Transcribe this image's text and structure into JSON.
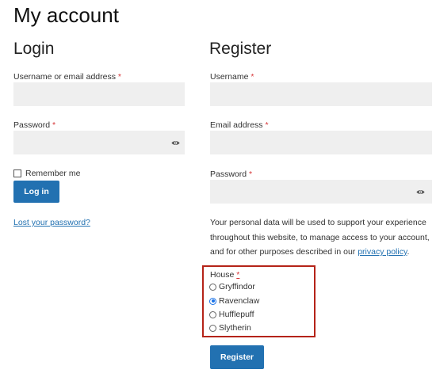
{
  "page": {
    "title": "My account"
  },
  "login": {
    "title": "Login",
    "username_label": "Username or email address",
    "password_label": "Password",
    "required_mark": "*",
    "remember_label": "Remember me",
    "submit_label": "Log in",
    "lost_password": "Lost your password?"
  },
  "register": {
    "title": "Register",
    "username_label": "Username",
    "email_label": "Email address",
    "password_label": "Password",
    "required_mark": "*",
    "privacy_text": "Your personal data will be used to support your experience throughout this website, to manage access to your account, and for other purposes described in our ",
    "privacy_link": "privacy policy",
    "privacy_end": ".",
    "house": {
      "label": "House",
      "required_mark": "*",
      "options": [
        "Gryffindor",
        "Ravenclaw",
        "Hufflepuff",
        "Slytherin"
      ],
      "selected": "Ravenclaw"
    },
    "submit_label": "Register"
  },
  "colors": {
    "accent": "#2271b1",
    "required": "#d63638",
    "highlight": "#b52318",
    "field_bg": "#efefef"
  },
  "icons": {
    "password_toggle": "eye-icon"
  }
}
